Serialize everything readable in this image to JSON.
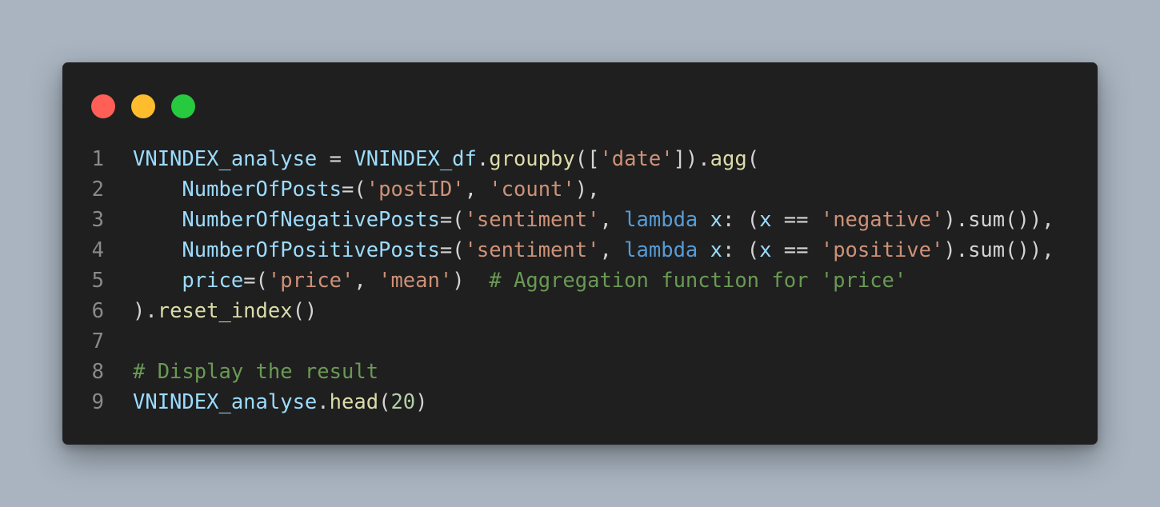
{
  "window": {
    "controls": [
      {
        "name": "close",
        "color": "#ff5f56"
      },
      {
        "name": "minimize",
        "color": "#ffbd2e"
      },
      {
        "name": "maximize",
        "color": "#27c93f"
      }
    ]
  },
  "code": {
    "line_numbers": [
      "1",
      "2",
      "3",
      "4",
      "5",
      "6",
      "7",
      "8",
      "9"
    ],
    "lines": [
      [
        {
          "t": "var",
          "v": "VNINDEX_analyse"
        },
        {
          "t": "pun",
          "v": " = "
        },
        {
          "t": "var",
          "v": "VNINDEX_df"
        },
        {
          "t": "pun",
          "v": "."
        },
        {
          "t": "fn",
          "v": "groupby"
        },
        {
          "t": "pun",
          "v": "(["
        },
        {
          "t": "str",
          "v": "'date'"
        },
        {
          "t": "pun",
          "v": "])."
        },
        {
          "t": "fn",
          "v": "agg"
        },
        {
          "t": "pun",
          "v": "("
        }
      ],
      [
        {
          "t": "pun",
          "v": "    "
        },
        {
          "t": "var",
          "v": "NumberOfPosts"
        },
        {
          "t": "pun",
          "v": "=("
        },
        {
          "t": "str",
          "v": "'postID'"
        },
        {
          "t": "pun",
          "v": ", "
        },
        {
          "t": "str",
          "v": "'count'"
        },
        {
          "t": "pun",
          "v": "),"
        }
      ],
      [
        {
          "t": "pun",
          "v": "    "
        },
        {
          "t": "var",
          "v": "NumberOfNegativePosts"
        },
        {
          "t": "pun",
          "v": "=("
        },
        {
          "t": "str",
          "v": "'sentiment'"
        },
        {
          "t": "pun",
          "v": ", "
        },
        {
          "t": "kw",
          "v": "lambda"
        },
        {
          "t": "pun",
          "v": " "
        },
        {
          "t": "var",
          "v": "x"
        },
        {
          "t": "pun",
          "v": ": ("
        },
        {
          "t": "var",
          "v": "x"
        },
        {
          "t": "pun",
          "v": " == "
        },
        {
          "t": "str",
          "v": "'negative'"
        },
        {
          "t": "pun",
          "v": ").sum()),"
        }
      ],
      [
        {
          "t": "pun",
          "v": "    "
        },
        {
          "t": "var",
          "v": "NumberOfPositivePosts"
        },
        {
          "t": "pun",
          "v": "=("
        },
        {
          "t": "str",
          "v": "'sentiment'"
        },
        {
          "t": "pun",
          "v": ", "
        },
        {
          "t": "kw",
          "v": "lambda"
        },
        {
          "t": "pun",
          "v": " "
        },
        {
          "t": "var",
          "v": "x"
        },
        {
          "t": "pun",
          "v": ": ("
        },
        {
          "t": "var",
          "v": "x"
        },
        {
          "t": "pun",
          "v": " == "
        },
        {
          "t": "str",
          "v": "'positive'"
        },
        {
          "t": "pun",
          "v": ").sum()),"
        }
      ],
      [
        {
          "t": "pun",
          "v": "    "
        },
        {
          "t": "var",
          "v": "price"
        },
        {
          "t": "pun",
          "v": "=("
        },
        {
          "t": "str",
          "v": "'price'"
        },
        {
          "t": "pun",
          "v": ", "
        },
        {
          "t": "str",
          "v": "'mean'"
        },
        {
          "t": "pun",
          "v": ")  "
        },
        {
          "t": "cmt",
          "v": "# Aggregation function for 'price'"
        }
      ],
      [
        {
          "t": "pun",
          "v": ")."
        },
        {
          "t": "fn",
          "v": "reset_index"
        },
        {
          "t": "pun",
          "v": "()"
        }
      ],
      [],
      [
        {
          "t": "cmt",
          "v": "# Display the result"
        }
      ],
      [
        {
          "t": "var",
          "v": "VNINDEX_analyse"
        },
        {
          "t": "pun",
          "v": "."
        },
        {
          "t": "fn",
          "v": "head"
        },
        {
          "t": "pun",
          "v": "("
        },
        {
          "t": "num",
          "v": "20"
        },
        {
          "t": "pun",
          "v": ")"
        }
      ]
    ]
  }
}
